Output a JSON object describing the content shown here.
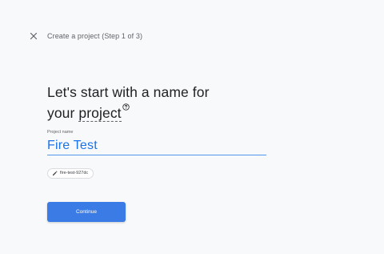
{
  "header": {
    "close_icon": "close-icon",
    "step_title": "Create a project (Step 1 of 3)"
  },
  "main": {
    "heading_line1": "Let's start with a name for",
    "heading_prefix": "your ",
    "heading_link": "project",
    "help_icon": "help-circle-icon",
    "field": {
      "label": "Project name",
      "value": "Fire Test"
    },
    "project_id_chip": {
      "icon": "pencil-icon",
      "text": "fire-test-927dc"
    },
    "continue_label": "Continue"
  },
  "colors": {
    "accent": "#1a73e8",
    "button": "#3b7be6",
    "background": "#f8f9fa"
  }
}
